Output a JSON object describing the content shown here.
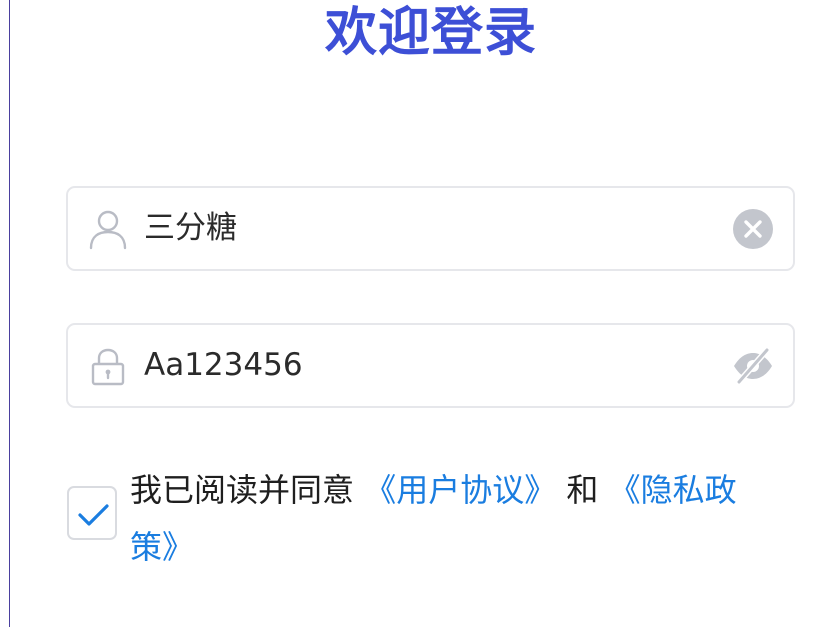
{
  "page": {
    "title": "欢迎登录"
  },
  "username": {
    "value": "三分糖",
    "lead_icon": "user-icon",
    "trail_icon": "clear-icon"
  },
  "password": {
    "value": "Aa123456",
    "lead_icon": "lock-icon",
    "trail_icon": "eye-off-icon"
  },
  "agreement": {
    "checked": true,
    "prefix": "我已阅读并同意 ",
    "user_agreement": "《用户协议》",
    "connector": " 和 ",
    "privacy_policy": "《隐私政策》"
  },
  "colors": {
    "title": "#3d4fd6",
    "link": "#1a7de0",
    "check": "#1a7de0",
    "field_border": "#e6e7eb",
    "icon": "#b9bcc5"
  }
}
